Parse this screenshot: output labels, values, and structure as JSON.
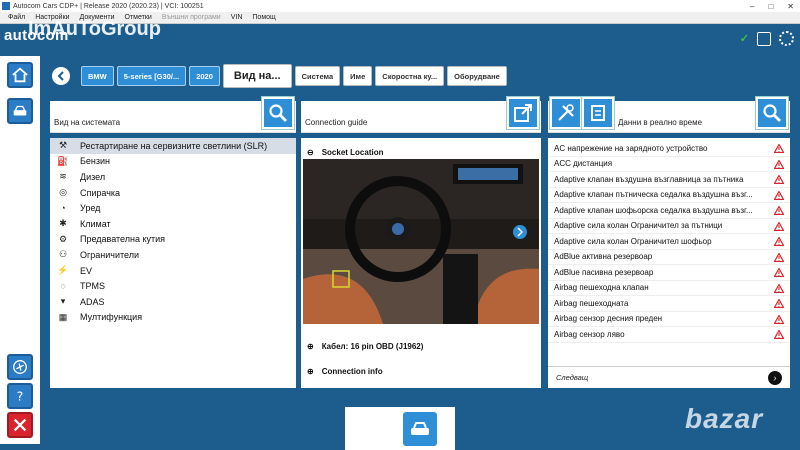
{
  "window": {
    "title": "Autocom Cars CDP+ | Release 2020 (2020.23) | VCI: 100251",
    "controls": [
      "–",
      "□",
      "✕"
    ]
  },
  "menu": {
    "items": [
      "Файл",
      "Настройки",
      "Документи",
      "Отметки",
      "Външни програми",
      "VIN",
      "Помощ"
    ]
  },
  "brand": {
    "logo": "autocom",
    "watermark": "ImAuToGroup"
  },
  "breadcrumb": {
    "items": [
      "BMW",
      "5-series [G30/...",
      "2020",
      "Вид на...",
      "Система",
      "Име",
      "Скоростна ку...",
      "Оборудване"
    ]
  },
  "system_panel": {
    "title": "Вид на системата",
    "items": [
      {
        "label": "Рестартиране на сервизните светлини (SLR)",
        "icon": "wrench-icon",
        "selected": true
      },
      {
        "label": "Бензин",
        "icon": "petrol-icon"
      },
      {
        "label": "Дизел",
        "icon": "diesel-icon"
      },
      {
        "label": "Спирачка",
        "icon": "brake-icon"
      },
      {
        "label": "Уред",
        "icon": "instrument-icon"
      },
      {
        "label": "Климат",
        "icon": "climate-icon"
      },
      {
        "label": "Предавателна кутия",
        "icon": "gearbox-icon"
      },
      {
        "label": "Ограничители",
        "icon": "srs-icon"
      },
      {
        "label": "EV",
        "icon": "ev-icon"
      },
      {
        "label": "TPMS",
        "icon": "tpms-icon"
      },
      {
        "label": "ADAS",
        "icon": "adas-icon"
      },
      {
        "label": "Мултифункция",
        "icon": "multifunction-icon"
      }
    ]
  },
  "connection_panel": {
    "title": "Connection guide",
    "socket_label": "Socket Location",
    "cable_label": "Кабел: 16 pin OBD (J1962)",
    "info_label": "Connection info"
  },
  "live_panel": {
    "title": "Данни в реално време",
    "items": [
      "AC напрежение на зарядното устройство",
      "ACC дистанция",
      "Adaptive клапан въздушна възглавница за пътника",
      "Adaptive клапан пътническа седалка въздушна възг...",
      "Adaptive клапан шофьорска седалка въздушна възг...",
      "Adaptive сила колан Ограничител за пътници",
      "Adaptive сила колан Ограничител шофьор",
      "AdBlue активна резервоар",
      "AdBlue пасивна резервоар",
      "Airbag пешеходна клапан",
      "Airbag пешеходната",
      "Airbag сензор десния преден",
      "Airbag сензор ляво"
    ],
    "next_label": "Следващ"
  },
  "overlay_watermark": "bazar",
  "colors": {
    "background": "#1d5d8e",
    "button": "#2e8fd6",
    "warning": "#d9232d",
    "check": "#3ec23e"
  }
}
